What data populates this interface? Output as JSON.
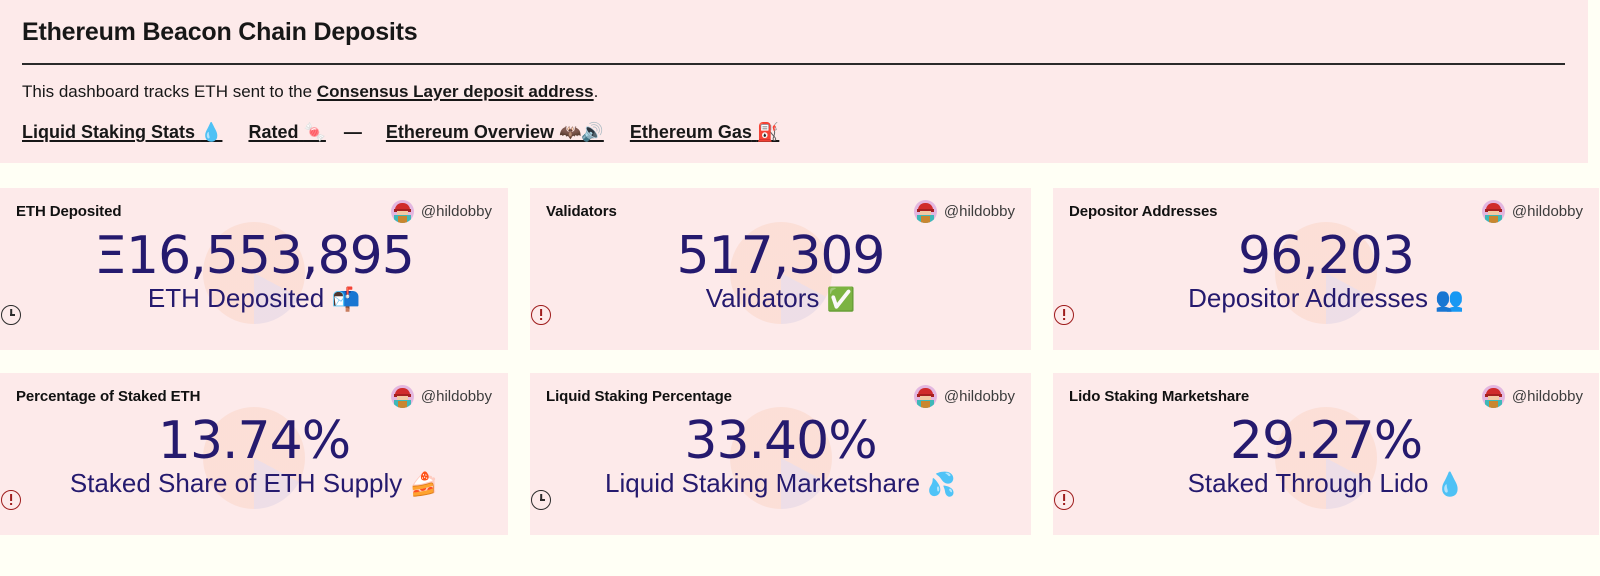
{
  "header": {
    "title": "Ethereum Beacon Chain Deposits",
    "description_prefix": "This dashboard tracks ETH sent to the ",
    "description_link": "Consensus Layer deposit address",
    "description_suffix": ".",
    "links": [
      {
        "label": "Liquid Staking Stats",
        "emoji": "💧"
      },
      {
        "label": "Rated",
        "emoji": "🍬"
      },
      {
        "label": "Ethereum Overview",
        "emoji": "🦇🔊"
      },
      {
        "label": "Ethereum Gas",
        "emoji": "⛽"
      }
    ],
    "separator": "—"
  },
  "author": {
    "handle": "@hildobby",
    "avatar_icon": "pixel-avatar-icon"
  },
  "cards": [
    {
      "title": "ETH Deposited",
      "value": "Ξ16,553,895",
      "sub_label": "ETH Deposited",
      "sub_emoji": "📬",
      "status_icon": "clock-icon"
    },
    {
      "title": "Validators",
      "value": "517,309",
      "sub_label": "Validators",
      "sub_emoji": "✅",
      "status_icon": "alert-icon"
    },
    {
      "title": "Depositor Addresses",
      "value": "96,203",
      "sub_label": "Depositor Addresses",
      "sub_emoji": "👥",
      "status_icon": "alert-icon"
    },
    {
      "title": "Percentage of Staked ETH",
      "value": "13.74%",
      "sub_label": "Staked Share of ETH Supply",
      "sub_emoji": "🍰",
      "status_icon": "alert-icon"
    },
    {
      "title": "Liquid Staking Percentage",
      "value": "33.40%",
      "sub_label": "Liquid Staking Marketshare",
      "sub_emoji": "💦",
      "status_icon": "clock-icon"
    },
    {
      "title": "Lido Staking Marketshare",
      "value": "29.27%",
      "sub_label": "Staked Through Lido",
      "sub_emoji": "💧",
      "status_icon": "alert-icon"
    }
  ],
  "colors": {
    "card_background": "#fdeaea",
    "page_background": "#fffff5",
    "value_text": "#251a6e",
    "alert": "#9e1c1c",
    "watermark_primary": "#fbdcd2",
    "watermark_secondary": "#e9dbe6"
  }
}
